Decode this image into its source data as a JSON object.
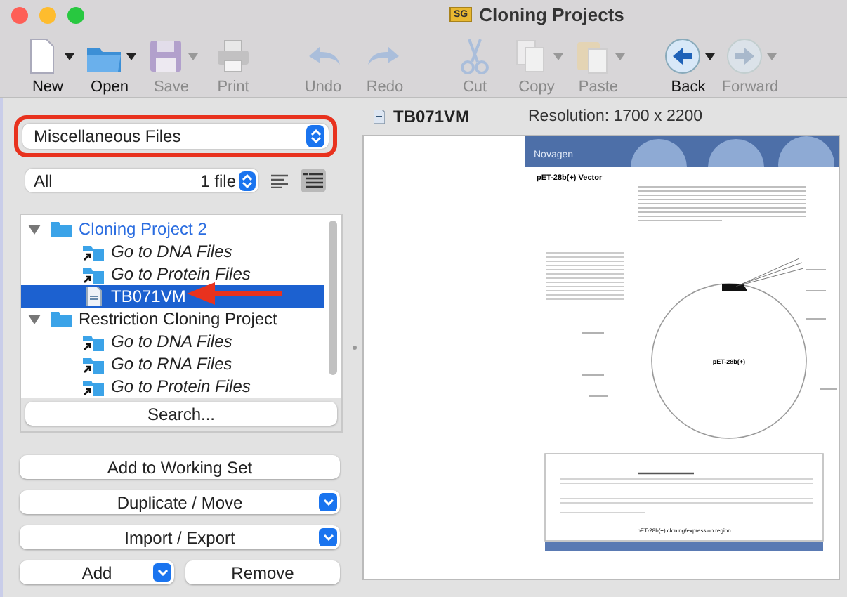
{
  "window": {
    "title": "Cloning Projects",
    "badge": "SG"
  },
  "toolbar": [
    {
      "label": "New",
      "disabled": false,
      "menu": true
    },
    {
      "label": "Open",
      "disabled": false,
      "menu": true
    },
    {
      "label": "Save",
      "disabled": true,
      "menu": true
    },
    {
      "label": "Print",
      "disabled": true,
      "menu": false
    },
    {
      "label": "Undo",
      "disabled": true,
      "menu": false
    },
    {
      "label": "Redo",
      "disabled": true,
      "menu": false
    },
    {
      "label": "Cut",
      "disabled": true,
      "menu": false
    },
    {
      "label": "Copy",
      "disabled": true,
      "menu": true
    },
    {
      "label": "Paste",
      "disabled": true,
      "menu": true
    },
    {
      "label": "Back",
      "disabled": false,
      "menu": true
    },
    {
      "label": "Forward",
      "disabled": true,
      "menu": true
    }
  ],
  "collection_select": {
    "value": "Miscellaneous Files"
  },
  "filter": {
    "value": "All",
    "count": "1 file"
  },
  "tree": [
    {
      "label": "Cloning Project 2",
      "kind": "folder",
      "expanded": true,
      "selected": false,
      "children": [
        {
          "label": "Go to DNA Files",
          "kind": "shortcut",
          "selected": false
        },
        {
          "label": "Go to Protein Files",
          "kind": "shortcut",
          "selected": false
        },
        {
          "label": "TB071VM",
          "kind": "file",
          "selected": true
        }
      ]
    },
    {
      "label": "Restriction Cloning Project",
      "kind": "folder",
      "expanded": true,
      "selected": false,
      "children": [
        {
          "label": "Go to DNA Files",
          "kind": "shortcut",
          "selected": false
        },
        {
          "label": "Go to RNA Files",
          "kind": "shortcut",
          "selected": false
        },
        {
          "label": "Go to Protein Files",
          "kind": "shortcut",
          "selected": false
        }
      ]
    }
  ],
  "search_button": "Search...",
  "actions": [
    {
      "label": "Add to Working Set",
      "kind": "button"
    },
    {
      "label": "Duplicate / Move",
      "kind": "menu"
    },
    {
      "label": "Import / Export",
      "kind": "menu"
    }
  ],
  "bottom_buttons": [
    {
      "label": "Add",
      "kind": "menu"
    },
    {
      "label": "Remove",
      "kind": "button"
    }
  ],
  "preview": {
    "file_name": "TB071VM",
    "resolution": "Resolution: 1700 x 2200",
    "document": {
      "logo": "Novagen",
      "title": "pET-28b(+) Vector",
      "map_label": "pET-28b(+)",
      "figure_caption": "pET-28b(+) cloning/expression region"
    }
  }
}
